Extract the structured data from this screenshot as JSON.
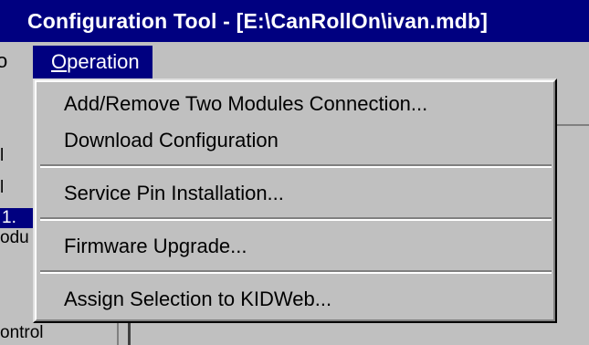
{
  "window": {
    "title": "Configuration Tool - [E:\\CanRollOn\\ivan.mdb]"
  },
  "menubar": {
    "prev_item_fragment": "o",
    "active_menu_label": "Operation",
    "active_menu_mnemonic": "O",
    "active_menu_rest": "peration"
  },
  "dropdown": {
    "items": [
      {
        "label": "Add/Remove Two Modules Connection..."
      },
      {
        "label": "Download Configuration"
      },
      {
        "label": "Service Pin Installation..."
      },
      {
        "label": "Firmware Upgrade..."
      },
      {
        "label": "Assign Selection to KIDWeb..."
      }
    ]
  },
  "background": {
    "left_fragments": [
      "l",
      "l",
      "1.",
      "odu"
    ],
    "bottom_fragment": "ontrol"
  },
  "colors": {
    "title_bg": "#000080",
    "menu_bg": "#c0c0c0",
    "highlight": "#000080"
  }
}
